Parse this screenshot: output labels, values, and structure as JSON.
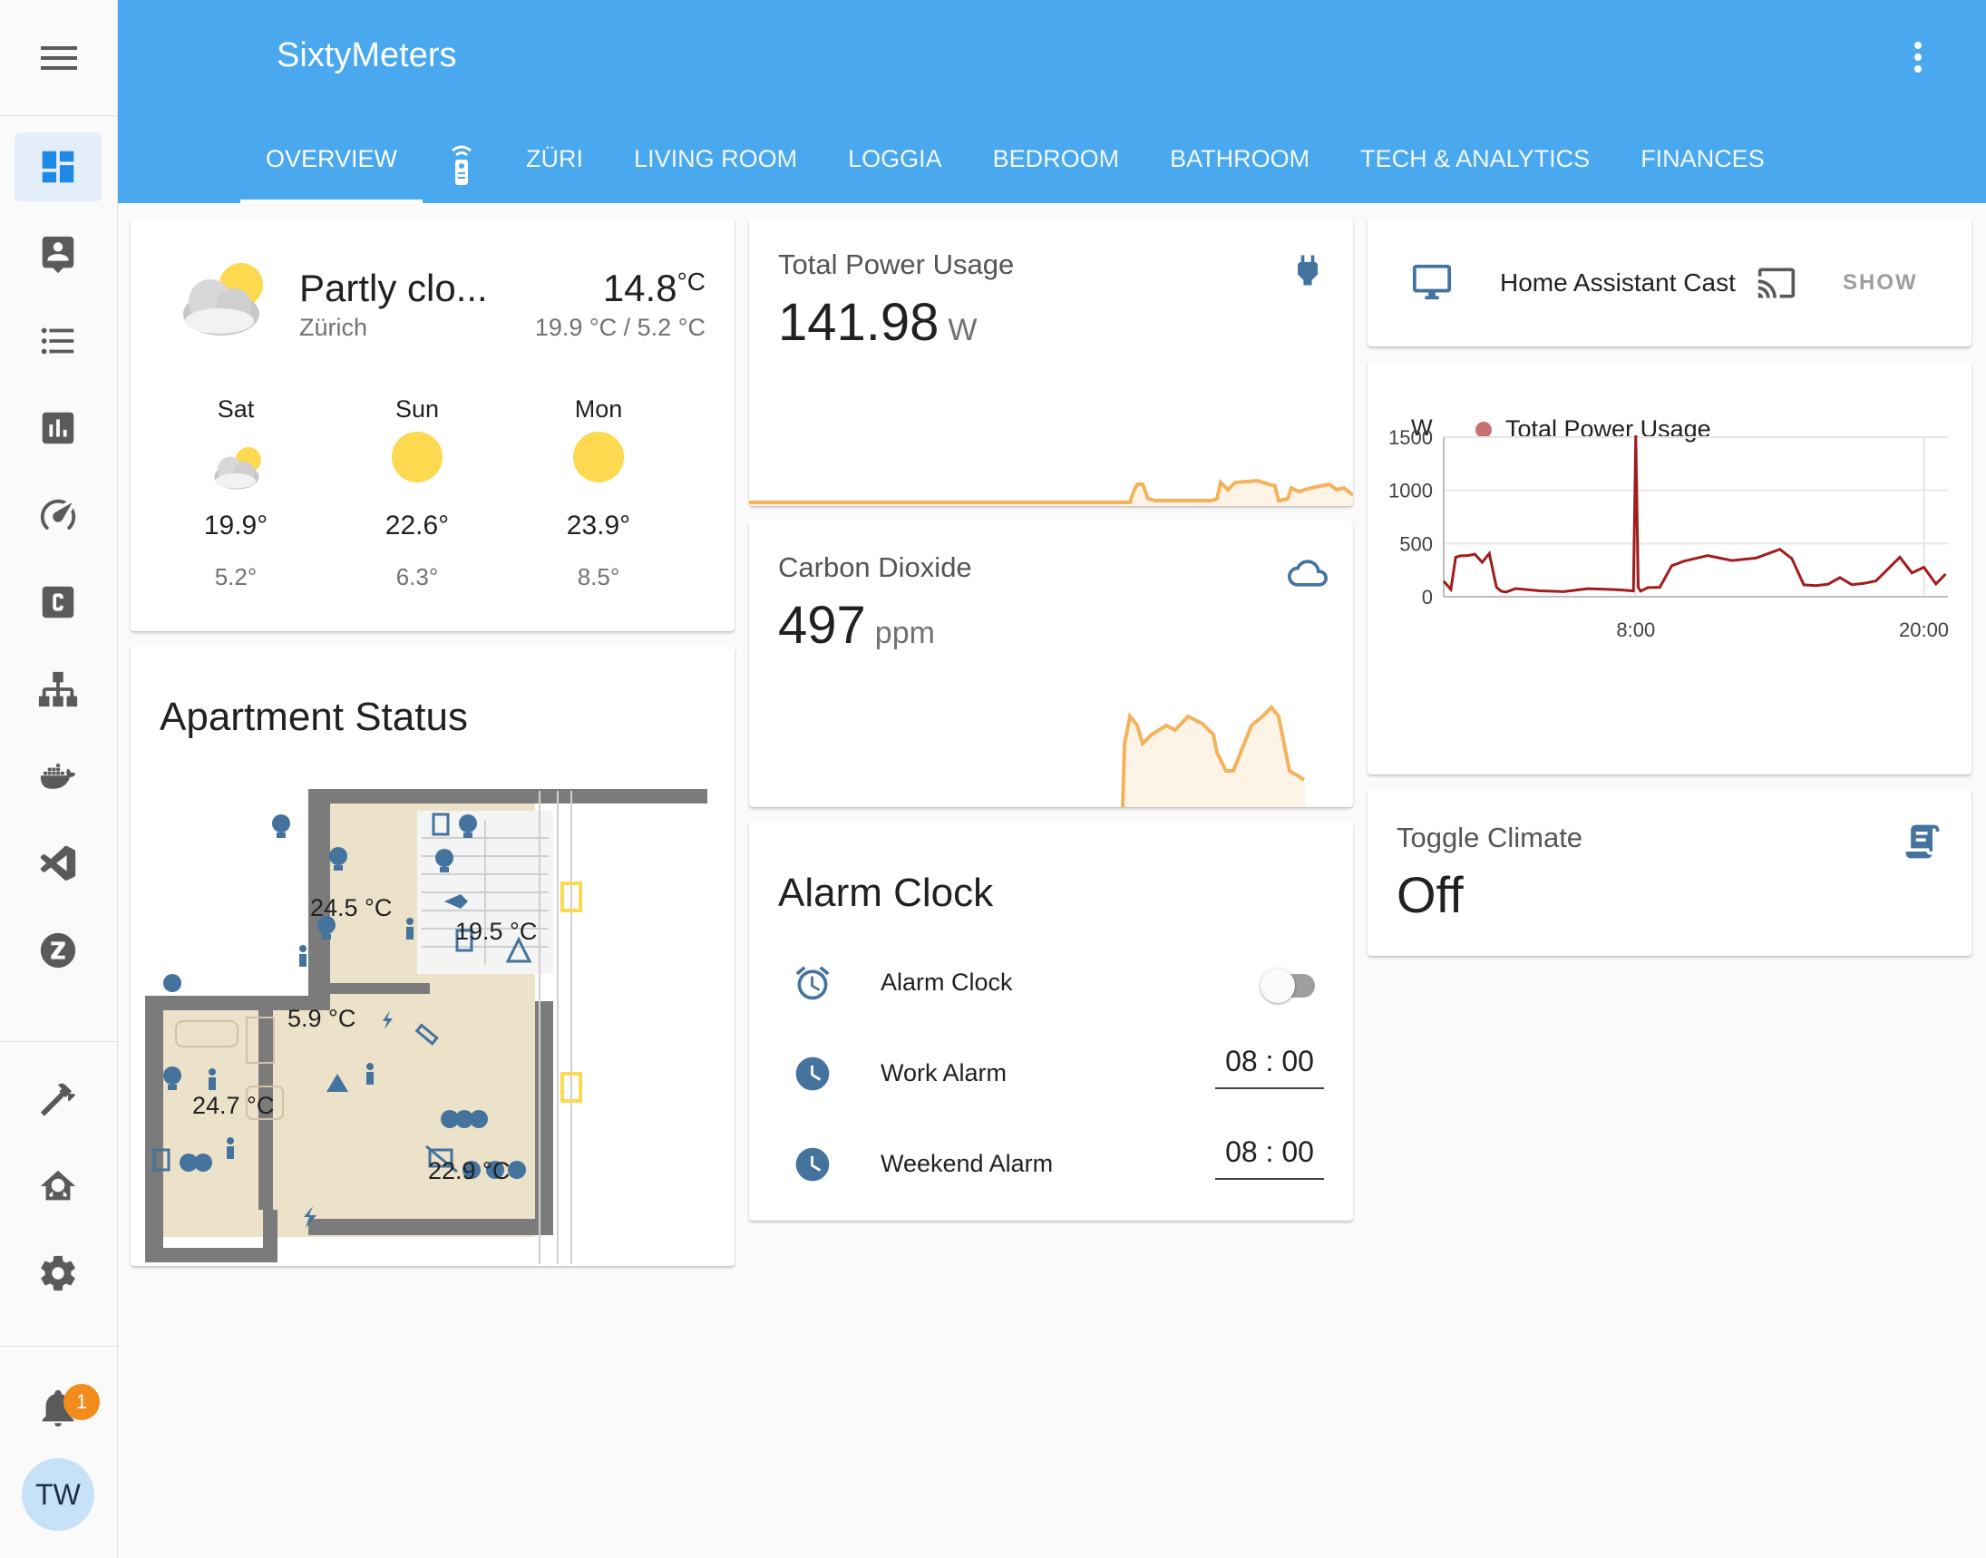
{
  "app": {
    "title": "SixtyMeters"
  },
  "tabs": [
    {
      "label": "OVERVIEW",
      "active": true
    },
    {
      "label": "",
      "icon": "remote-icon"
    },
    {
      "label": "ZÜRI"
    },
    {
      "label": "LIVING ROOM"
    },
    {
      "label": "LOGGIA"
    },
    {
      "label": "BEDROOM"
    },
    {
      "label": "BATHROOM"
    },
    {
      "label": "TECH & ANALYTICS"
    },
    {
      "label": "FINANCES"
    }
  ],
  "sidebar": {
    "items": [
      {
        "icon": "dashboard-icon",
        "active": true
      },
      {
        "icon": "account-box-icon"
      },
      {
        "icon": "list-icon"
      },
      {
        "icon": "chart-icon"
      },
      {
        "icon": "gauge-icon"
      },
      {
        "icon": "c-box-icon"
      },
      {
        "icon": "sitemap-icon"
      },
      {
        "icon": "docker-icon"
      },
      {
        "icon": "vscode-icon"
      },
      {
        "icon": "z-circle-icon"
      },
      {
        "icon": "hammer-icon"
      },
      {
        "icon": "home-network-icon"
      },
      {
        "icon": "gear-icon"
      }
    ],
    "notifications_count": "1",
    "user_initials": "TW"
  },
  "weather": {
    "condition": "Partly clo...",
    "location": "Zürich",
    "temperature": "14.8",
    "temperature_unit": "°C",
    "range": "19.9 °C / 5.2 °C",
    "forecast": [
      {
        "day": "Sat",
        "high": "19.9°",
        "low": "5.2°",
        "icon": "partly-cloudy-icon"
      },
      {
        "day": "Sun",
        "high": "22.6°",
        "low": "6.3°",
        "icon": "sunny-icon"
      },
      {
        "day": "Mon",
        "high": "23.9°",
        "low": "8.5°",
        "icon": "sunny-icon"
      }
    ]
  },
  "apartment": {
    "title": "Apartment Status",
    "temps": {
      "bedroom": "24.5 °C",
      "loggia": "19.5 °C",
      "kitchen": "5.9 °C",
      "bathroom": "24.7 °C",
      "living": "22.9 °C"
    }
  },
  "power": {
    "title": "Total Power Usage",
    "value": "141.98",
    "unit": "W",
    "icon": "power-plug-icon"
  },
  "co2": {
    "title": "Carbon Dioxide",
    "value": "497",
    "unit": "ppm",
    "icon": "cloud-outline-icon"
  },
  "alarm": {
    "title": "Alarm Clock",
    "rows": [
      {
        "label": "Alarm Clock",
        "type": "toggle",
        "state": "off"
      },
      {
        "label": "Work Alarm",
        "type": "time",
        "value": "08 : 00"
      },
      {
        "label": "Weekend Alarm",
        "type": "time",
        "value": "08 : 00"
      }
    ]
  },
  "cast": {
    "label": "Home Assistant Cast",
    "action": "SHOW"
  },
  "climate": {
    "title": "Toggle Climate",
    "value": "Off"
  },
  "chart_data": {
    "type": "line",
    "title": "",
    "legend": "Total Power Usage",
    "legend_placement": "top",
    "ylabel": "W",
    "xlabel": "",
    "ylim": [
      0,
      1500
    ],
    "yticks": [
      "0",
      "500",
      "1000",
      "1500"
    ],
    "xticks": [
      "8:00",
      "20:00"
    ],
    "grid": true,
    "color": "#a11c1c",
    "series": [
      {
        "name": "Total Power Usage",
        "x_hours": [
          0,
          0.3,
          0.5,
          0.7,
          1.0,
          1.3,
          1.6,
          1.9,
          2.2,
          2.4,
          2.6,
          3,
          4,
          5,
          6,
          7,
          7.5,
          7.9,
          8.0,
          8.1,
          8.2,
          8.5,
          9,
          9.5,
          10,
          11,
          12,
          13,
          14,
          14.5,
          15,
          15.5,
          16,
          16.5,
          17,
          17.5,
          18,
          19,
          19.5,
          20,
          20.5,
          20.9
        ],
        "y": [
          120,
          60,
          380,
          410,
          370,
          400,
          340,
          380,
          80,
          60,
          70,
          60,
          55,
          65,
          50,
          60,
          70,
          80,
          1500,
          90,
          70,
          60,
          80,
          300,
          360,
          370,
          340,
          380,
          420,
          350,
          120,
          130,
          100,
          180,
          130,
          100,
          140,
          380,
          250,
          260,
          120,
          230
        ]
      }
    ]
  },
  "colors": {
    "header": "#4aa8ee",
    "accent": "#1e88e5",
    "icon_blue": "#44739e",
    "sensor_line": "#f5b25c",
    "sensor_fill": "#fdf3e6",
    "chart_line": "#a11c1c",
    "badge": "#f28c1c",
    "floor": "#ece1c9",
    "wall": "#7b7b7b"
  }
}
